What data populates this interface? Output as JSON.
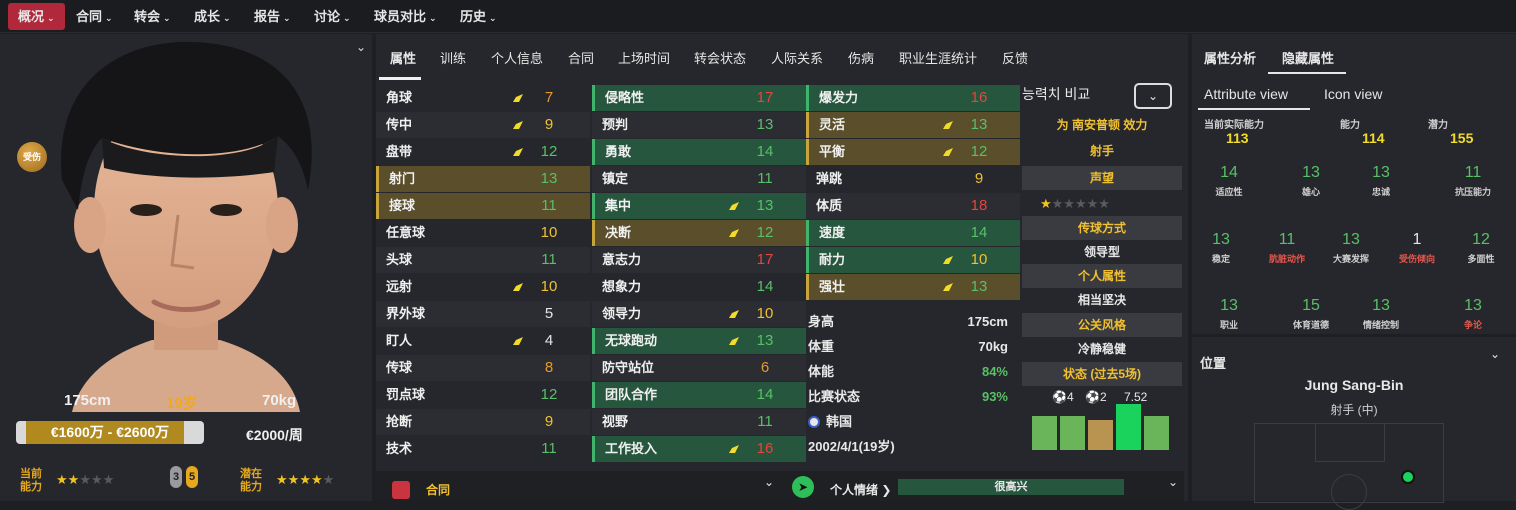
{
  "topnav": {
    "items": [
      {
        "label": "概况",
        "active": true
      },
      {
        "label": "合同"
      },
      {
        "label": "转会"
      },
      {
        "label": "成长"
      },
      {
        "label": "报告"
      },
      {
        "label": "讨论"
      },
      {
        "label": "球员对比"
      },
      {
        "label": "历史"
      }
    ]
  },
  "player_card": {
    "injury_badge": "受伤",
    "height": "175cm",
    "age": "19岁",
    "weight": "70kg",
    "value_range": "€1600万 - €2600万",
    "wage": "€2000/周",
    "current_ability_label": "当前能力",
    "current_stars": 2,
    "potential_label": "潜在能力",
    "potential_stars": 3.5,
    "chip_left": "3",
    "chip_right": "5"
  },
  "tabs": [
    "属性",
    "训练",
    "个人信息",
    "合同",
    "上场时间",
    "转会状态",
    "人际关系",
    "伤病",
    "职业生涯统计",
    "反馈"
  ],
  "attributes": {
    "technical": [
      {
        "name": "角球",
        "value": "7",
        "color": "orange",
        "arrow": true,
        "hl": "plain"
      },
      {
        "name": "传中",
        "value": "9",
        "color": "yellow",
        "arrow": true,
        "hl": "alt"
      },
      {
        "name": "盘带",
        "value": "12",
        "color": "green",
        "arrow": true,
        "hl": "plain"
      },
      {
        "name": "射门",
        "value": "13",
        "color": "green",
        "arrow": false,
        "hl": "gold"
      },
      {
        "name": "接球",
        "value": "11",
        "color": "green",
        "arrow": false,
        "hl": "gold"
      },
      {
        "name": "任意球",
        "value": "10",
        "color": "yellow",
        "arrow": false,
        "hl": "plain"
      },
      {
        "name": "头球",
        "value": "11",
        "color": "green",
        "arrow": false,
        "hl": "alt"
      },
      {
        "name": "远射",
        "value": "10",
        "color": "yellow",
        "arrow": true,
        "hl": "plain"
      },
      {
        "name": "界外球",
        "value": "5",
        "color": "white",
        "arrow": false,
        "hl": "alt"
      },
      {
        "name": "盯人",
        "value": "4",
        "color": "white",
        "arrow": true,
        "hl": "plain"
      },
      {
        "name": "传球",
        "value": "8",
        "color": "orange",
        "arrow": false,
        "hl": "alt"
      },
      {
        "name": "罚点球",
        "value": "12",
        "color": "green",
        "arrow": false,
        "hl": "plain"
      },
      {
        "name": "抢断",
        "value": "9",
        "color": "yellow",
        "arrow": false,
        "hl": "alt"
      },
      {
        "name": "技术",
        "value": "11",
        "color": "green",
        "arrow": false,
        "hl": "plain"
      }
    ],
    "mental": [
      {
        "name": "侵略性",
        "value": "17",
        "color": "red",
        "arrow": false,
        "hl": "green"
      },
      {
        "name": "预判",
        "value": "13",
        "color": "green",
        "arrow": false,
        "hl": "alt"
      },
      {
        "name": "勇敢",
        "value": "14",
        "color": "green",
        "arrow": false,
        "hl": "green"
      },
      {
        "name": "镇定",
        "value": "11",
        "color": "green",
        "arrow": false,
        "hl": "alt"
      },
      {
        "name": "集中",
        "value": "13",
        "color": "green",
        "arrow": true,
        "hl": "green"
      },
      {
        "name": "决断",
        "value": "12",
        "color": "green",
        "arrow": true,
        "hl": "gold"
      },
      {
        "name": "意志力",
        "value": "17",
        "color": "red",
        "arrow": false,
        "hl": "alt"
      },
      {
        "name": "想象力",
        "value": "14",
        "color": "green",
        "arrow": false,
        "hl": "plain"
      },
      {
        "name": "领导力",
        "value": "10",
        "color": "yellow",
        "arrow": true,
        "hl": "alt"
      },
      {
        "name": "无球跑动",
        "value": "13",
        "color": "green",
        "arrow": true,
        "hl": "green"
      },
      {
        "name": "防守站位",
        "value": "6",
        "color": "orange",
        "arrow": false,
        "hl": "alt"
      },
      {
        "name": "团队合作",
        "value": "14",
        "color": "green",
        "arrow": false,
        "hl": "green"
      },
      {
        "name": "视野",
        "value": "11",
        "color": "green",
        "arrow": false,
        "hl": "alt"
      },
      {
        "name": "工作投入",
        "value": "16",
        "color": "red",
        "arrow": true,
        "hl": "green"
      }
    ],
    "physical": [
      {
        "name": "爆发力",
        "value": "16",
        "color": "red",
        "arrow": false,
        "hl": "green"
      },
      {
        "name": "灵活",
        "value": "13",
        "color": "green",
        "arrow": true,
        "hl": "gold"
      },
      {
        "name": "平衡",
        "value": "12",
        "color": "green",
        "arrow": true,
        "hl": "gold"
      },
      {
        "name": "弹跳",
        "value": "9",
        "color": "yellow",
        "arrow": false,
        "hl": "plain"
      },
      {
        "name": "体质",
        "value": "18",
        "color": "red",
        "arrow": false,
        "hl": "alt"
      },
      {
        "name": "速度",
        "value": "14",
        "color": "green",
        "arrow": false,
        "hl": "green"
      },
      {
        "name": "耐力",
        "value": "10",
        "color": "yellow",
        "arrow": true,
        "hl": "green"
      },
      {
        "name": "强壮",
        "value": "13",
        "color": "green",
        "arrow": true,
        "hl": "gold"
      }
    ]
  },
  "info": {
    "height_label": "身高",
    "height_value": "175cm",
    "weight_label": "体重",
    "weight_value": "70kg",
    "stamina_label": "体能",
    "stamina_value": "84%",
    "match_label": "比赛状态",
    "match_value": "93%",
    "nation": "韩国",
    "dob": "2002/4/1(19岁)"
  },
  "side": {
    "compare_label": "능력치 비교",
    "club_line": "为 南安普顿 效力",
    "role": "射手",
    "reputation_head": "声望",
    "passing_head": "传球方式",
    "passing_value": "领导型",
    "personality_head": "个人属性",
    "personality_value": "相当坚决",
    "media_head": "公关风格",
    "media_value": "冷静稳健",
    "form_head": "状态 (过去5场)",
    "goals": "4",
    "assists": "2",
    "rating": "7.52"
  },
  "footer": {
    "contract_label": "合同",
    "mood_label": "个人情绪",
    "mood_value": "很高兴"
  },
  "right_panel": {
    "tab1": "属性分析",
    "tab2": "隐藏属性",
    "view1": "Attribute view",
    "view2": "Icon view",
    "top": [
      {
        "label": "当前实际能力",
        "value": "113"
      },
      {
        "label": "能力",
        "value": "114"
      },
      {
        "label": "潜力",
        "value": "155"
      }
    ],
    "hidden": [
      {
        "label": "适应性",
        "value": "14",
        "lc": "#cfcfcf"
      },
      {
        "label": "雄心",
        "value": "13",
        "lc": "#cfcfcf"
      },
      {
        "label": "忠诚",
        "value": "13",
        "lc": "#cfcfcf"
      },
      {
        "label": "抗压能力",
        "value": "11",
        "lc": "#cfcfcf"
      },
      {
        "label": "稳定",
        "value": "13",
        "lc": "#cfcfcf"
      },
      {
        "label": "肮脏动作",
        "value": "11",
        "lc": "#e5574b"
      },
      {
        "label": "大赛发挥",
        "value": "13",
        "lc": "#cfcfcf"
      },
      {
        "label": "受伤倾向",
        "value": "1",
        "lc": "#e5574b"
      },
      {
        "label": "多面性",
        "value": "12",
        "lc": "#cfcfcf"
      },
      {
        "label": "职业",
        "value": "13",
        "lc": "#cfcfcf"
      },
      {
        "label": "体育道德",
        "value": "15",
        "lc": "#cfcfcf"
      },
      {
        "label": "情绪控制",
        "value": "13",
        "lc": "#cfcfcf"
      },
      {
        "label": "争论",
        "value": "13",
        "lc": "#e5574b"
      }
    ],
    "position_title": "位置",
    "player_name": "Jung Sang-Bin",
    "position_value": "射手 (中)"
  }
}
